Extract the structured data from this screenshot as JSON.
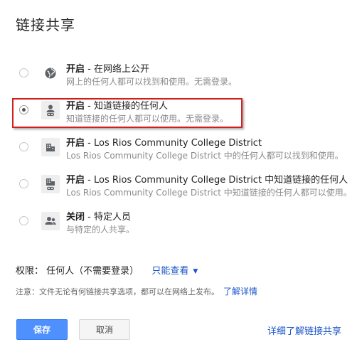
{
  "dialog": {
    "title": "链接共享"
  },
  "options": [
    {
      "id": "on-public",
      "title_bold": "开启",
      "title_rest": " - 在网络上公开",
      "desc": "网上的任何人都可以找到和使用。无需登录。",
      "icon": "globe-icon",
      "selected": false
    },
    {
      "id": "on-anyone-link",
      "title_bold": "开启",
      "title_rest": " - 知道链接的任何人",
      "desc": "知道链接的任何人都可以使用。无需登录。",
      "icon": "person-link-icon",
      "selected": true
    },
    {
      "id": "on-org",
      "title_bold": "开启",
      "title_rest": " - Los Rios Community College District",
      "desc": "Los Rios Community College District 中的任何人都可以找到和使用。",
      "icon": "building-icon",
      "selected": false
    },
    {
      "id": "on-org-link",
      "title_bold": "开启",
      "title_rest": " - Los Rios Community College District 中知道链接的任何人",
      "desc": "Los Rios Community College District 中知道链接的任何人都可以使用。",
      "icon": "building-link-icon",
      "selected": false
    },
    {
      "id": "off",
      "title_bold": "关闭",
      "title_rest": " - 特定人员",
      "desc": "与特定的人共享。",
      "icon": "people-icon",
      "selected": false
    }
  ],
  "permissions": {
    "label": "权限：",
    "who": "任何人（不需要登录）",
    "level": "只能查看"
  },
  "note": {
    "text": "注意：文件无论有何链接共享选项，都可以在网络上发布。",
    "link": "了解详情"
  },
  "buttons": {
    "save": "保存",
    "cancel": "取消"
  },
  "learn_more": "详细了解链接共享",
  "colors": {
    "accent": "#4d90fe",
    "link": "#1a55c9",
    "highlight": "#d11f1f"
  }
}
